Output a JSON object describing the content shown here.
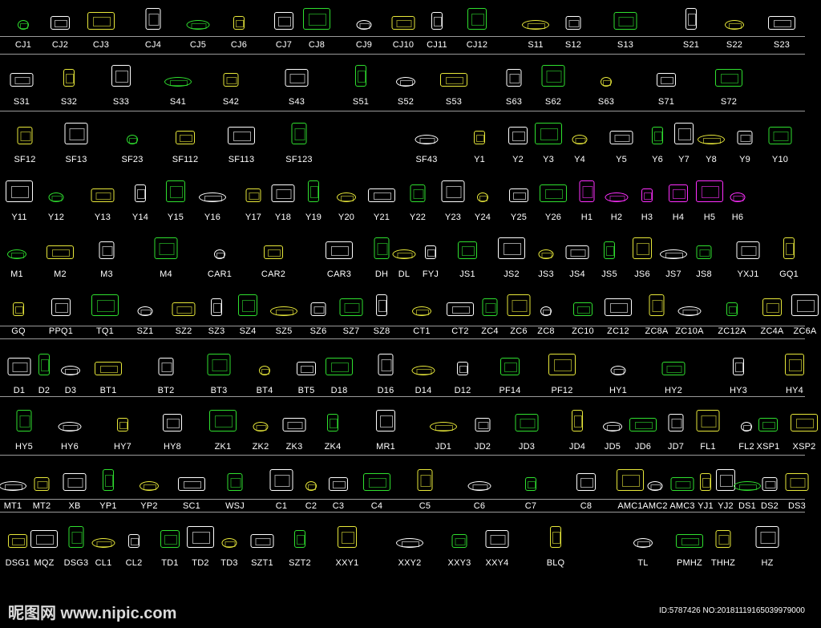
{
  "rows": [
    [
      "CJ1",
      "CJ2",
      "CJ3",
      "CJ4",
      "CJ5",
      "CJ6",
      "CJ7",
      "CJ8",
      "CJ9",
      "CJ10",
      "CJ11",
      "CJ12",
      "S11",
      "S12",
      "S13",
      "S21",
      "S22",
      "S23"
    ],
    [
      "S31",
      "S32",
      "S33",
      "S41",
      "S42",
      "S43",
      "S51",
      "S52",
      "S53",
      "S63",
      "S62",
      "S63",
      "S71",
      "S72"
    ],
    [
      "SF12",
      "SF13",
      "SF23",
      "SF112",
      "SF113",
      "SF123",
      "SF43",
      "Y1",
      "Y2",
      "Y3",
      "Y4",
      "Y5",
      "Y6",
      "Y7",
      "Y8",
      "Y9",
      "Y10"
    ],
    [
      "Y11",
      "Y12",
      "Y13",
      "Y14",
      "Y15",
      "Y16",
      "Y17",
      "Y18",
      "Y19",
      "Y20",
      "Y21",
      "Y22",
      "Y23",
      "Y24",
      "Y25",
      "Y26",
      "H1",
      "H2",
      "H3",
      "H4",
      "H5",
      "H6"
    ],
    [
      "M1",
      "M2",
      "M3",
      "M4",
      "CAR1",
      "CAR2",
      "CAR3",
      "DH",
      "DL",
      "FYJ",
      "JS1",
      "JS2",
      "JS3",
      "JS4",
      "JS5",
      "JS6",
      "JS7",
      "JS8",
      "YXJ1",
      "GQ1"
    ],
    [
      "GQ",
      "PPQ1",
      "TQ1",
      "SZ1",
      "SZ2",
      "SZ3",
      "SZ4",
      "SZ5",
      "SZ6",
      "SZ7",
      "SZ8",
      "CT1",
      "CT2",
      "ZC4",
      "ZC6",
      "ZC8",
      "ZC10",
      "ZC12",
      "ZC8A",
      "ZC10A",
      "ZC12A",
      "ZC4A",
      "ZC6A"
    ],
    [
      "D1",
      "D2",
      "D3",
      "BT1",
      "BT2",
      "BT3",
      "BT4",
      "BT5",
      "D18",
      "D16",
      "D14",
      "D12",
      "PF14",
      "PF12",
      "HY1",
      "HY2",
      "HY3",
      "HY4"
    ],
    [
      "HY5",
      "HY6",
      "HY7",
      "HY8",
      "ZK1",
      "ZK2",
      "ZK3",
      "ZK4",
      "MR1",
      "JD1",
      "JD2",
      "JD3",
      "JD4",
      "JD5",
      "JD6",
      "JD7",
      "FL1",
      "FL2",
      "XSP1",
      "XSP2"
    ],
    [
      "MT1",
      "MT2",
      "XB",
      "YP1",
      "YP2",
      "SC1",
      "WSJ",
      "C1",
      "C2",
      "C3",
      "C4",
      "C5",
      "C6",
      "C7",
      "C8",
      "AMC1",
      "AMC2",
      "AMC3",
      "YJ1",
      "YJ2",
      "DS1",
      "DS2",
      "DS3"
    ],
    [
      "DSG1",
      "MQZ",
      "DSG3",
      "CL1",
      "CL2",
      "TD1",
      "TD2",
      "TD3",
      "SZT1",
      "SZT2",
      "XXY1",
      "XXY2",
      "XXY3",
      "XXY4",
      "BLQ",
      "TL",
      "PMHZ",
      "THHZ",
      "HZ"
    ]
  ],
  "watermark": "昵图网 www.nipic.com",
  "id_text": "ID:5787426 NO:20181119165039979000",
  "colors": {
    "background": "#000000",
    "line": "#ffffff",
    "green": "#2fe02f",
    "yellow": "#e8e83a",
    "magenta": "#ff2fff",
    "red": "#e03030"
  }
}
